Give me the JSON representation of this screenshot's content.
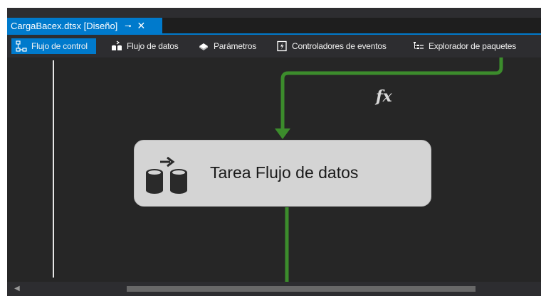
{
  "document_tab": {
    "title": "CargaBacex.dtsx [Diseño]",
    "pin_glyph": "⊸",
    "close_glyph": "✕"
  },
  "designer_tabs": [
    {
      "label": "Flujo de control",
      "icon": "control-flow-icon",
      "active": true
    },
    {
      "label": "Flujo de datos",
      "icon": "data-flow-icon",
      "active": false
    },
    {
      "label": "Parámetros",
      "icon": "parameters-icon",
      "active": false
    },
    {
      "label": "Controladores de eventos",
      "icon": "event-handlers-icon",
      "active": false
    },
    {
      "label": "Explorador de paquetes",
      "icon": "package-explorer-icon",
      "active": false
    }
  ],
  "canvas": {
    "expression_icon": "fx-expression-icon",
    "task": {
      "label": "Tarea Flujo de datos",
      "icon": "data-flow-task-icon"
    }
  },
  "colors": {
    "accent": "#007acc",
    "precedence_constraint": "#3c8c2c",
    "task_background": "#d4d4d4",
    "canvas_background": "#262626"
  }
}
